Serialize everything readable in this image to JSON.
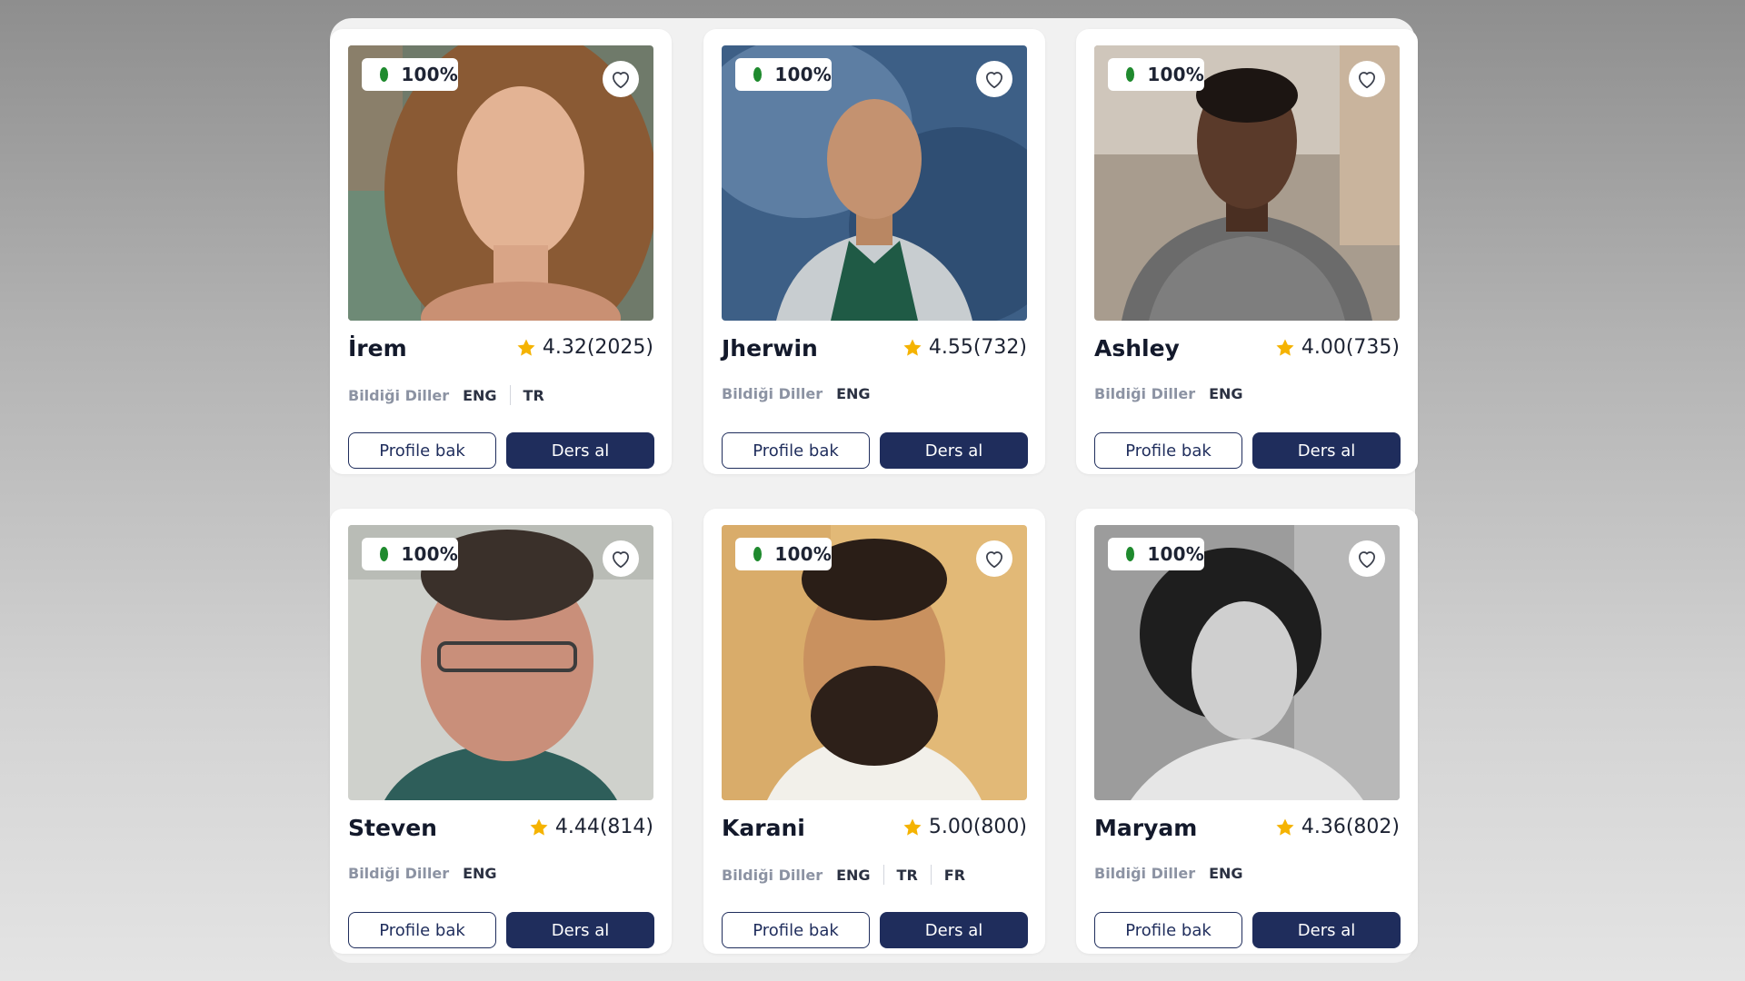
{
  "colors": {
    "primary": "#1f2d5c",
    "online_dot": "#1f8a2e",
    "star": "#f5b301"
  },
  "tutors": [
    {
      "name": "İrem",
      "status": "100%",
      "rating": "4.32",
      "reviews": "(2025)",
      "languages_label": "Bildiği Diller",
      "languages": [
        "ENG",
        "TR"
      ],
      "profile_button": "Profile bak",
      "lesson_button": "Ders al",
      "favorite_icon": "heart-icon"
    },
    {
      "name": "Jherwin",
      "status": "100%",
      "rating": "4.55",
      "reviews": "(732)",
      "languages_label": "Bildiği Diller",
      "languages": [
        "ENG"
      ],
      "profile_button": "Profile bak",
      "lesson_button": "Ders al",
      "favorite_icon": "heart-icon"
    },
    {
      "name": "Ashley",
      "status": "100%",
      "rating": "4.00",
      "reviews": "(735)",
      "languages_label": "Bildiği Diller",
      "languages": [
        "ENG"
      ],
      "profile_button": "Profile bak",
      "lesson_button": "Ders al",
      "favorite_icon": "heart-icon"
    },
    {
      "name": "Steven",
      "status": "100%",
      "rating": "4.44",
      "reviews": "(814)",
      "languages_label": "Bildiği Diller",
      "languages": [
        "ENG"
      ],
      "profile_button": "Profile bak",
      "lesson_button": "Ders al",
      "favorite_icon": "heart-icon"
    },
    {
      "name": "Karani",
      "status": "100%",
      "rating": "5.00",
      "reviews": "(800)",
      "languages_label": "Bildiği Diller",
      "languages": [
        "ENG",
        "TR",
        "FR"
      ],
      "profile_button": "Profile bak",
      "lesson_button": "Ders al",
      "favorite_icon": "heart-icon"
    },
    {
      "name": "Maryam",
      "status": "100%",
      "rating": "4.36",
      "reviews": "(802)",
      "languages_label": "Bildiği Diller",
      "languages": [
        "ENG"
      ],
      "profile_button": "Profile bak",
      "lesson_button": "Ders al",
      "favorite_icon": "heart-icon"
    }
  ]
}
